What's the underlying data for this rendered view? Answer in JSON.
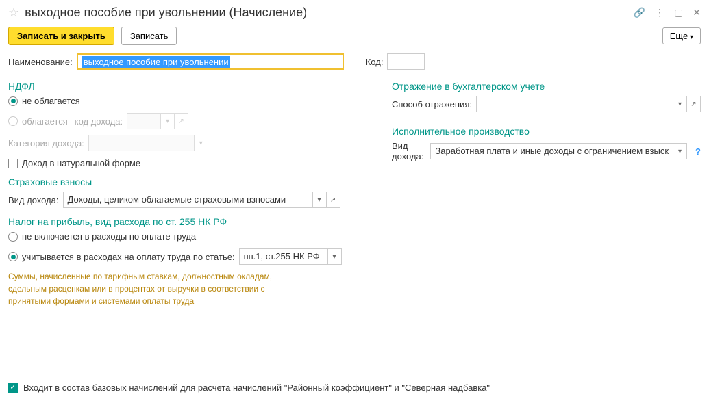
{
  "header": {
    "title": "выходное пособие при увольнении (Начисление)"
  },
  "toolbar": {
    "save_close": "Записать и закрыть",
    "save": "Записать",
    "more": "Еще"
  },
  "fields": {
    "name_label": "Наименование:",
    "name_value": "выходное пособие при увольнении",
    "code_label": "Код:",
    "code_value": ""
  },
  "ndfl": {
    "title": "НДФЛ",
    "not_taxed": "не облагается",
    "taxed": "облагается",
    "income_code_label": "код дохода:",
    "income_code_value": "",
    "category_label": "Категория дохода:",
    "category_value": "",
    "natural_form": "Доход в натуральной форме"
  },
  "insurance": {
    "title": "Страховые взносы",
    "income_type_label": "Вид дохода:",
    "income_type_value": "Доходы, целиком облагаемые страховыми взносами"
  },
  "profit_tax": {
    "title": "Налог на прибыль, вид расхода по ст. 255 НК РФ",
    "not_included": "не включается в расходы по оплате труда",
    "included": "учитывается в расходах на оплату труда по статье:",
    "article_value": "пп.1, ст.255 НК РФ",
    "hint": "Суммы, начисленные по тарифным ставкам, должностным окладам, сдельным расценкам или в процентах от выручки в соответствии с принятыми формами и системами оплаты труда"
  },
  "accounting": {
    "title": "Отражение в бухгалтерском учете",
    "method_label": "Способ отражения:",
    "method_value": ""
  },
  "enforcement": {
    "title": "Исполнительное производство",
    "income_type_label": "Вид дохода:",
    "income_type_value": "Заработная плата и иные доходы с ограничением взыск"
  },
  "footer": {
    "base_accruals": "Входит в состав базовых начислений для расчета начислений \"Районный коэффициент\" и \"Северная надбавка\""
  }
}
